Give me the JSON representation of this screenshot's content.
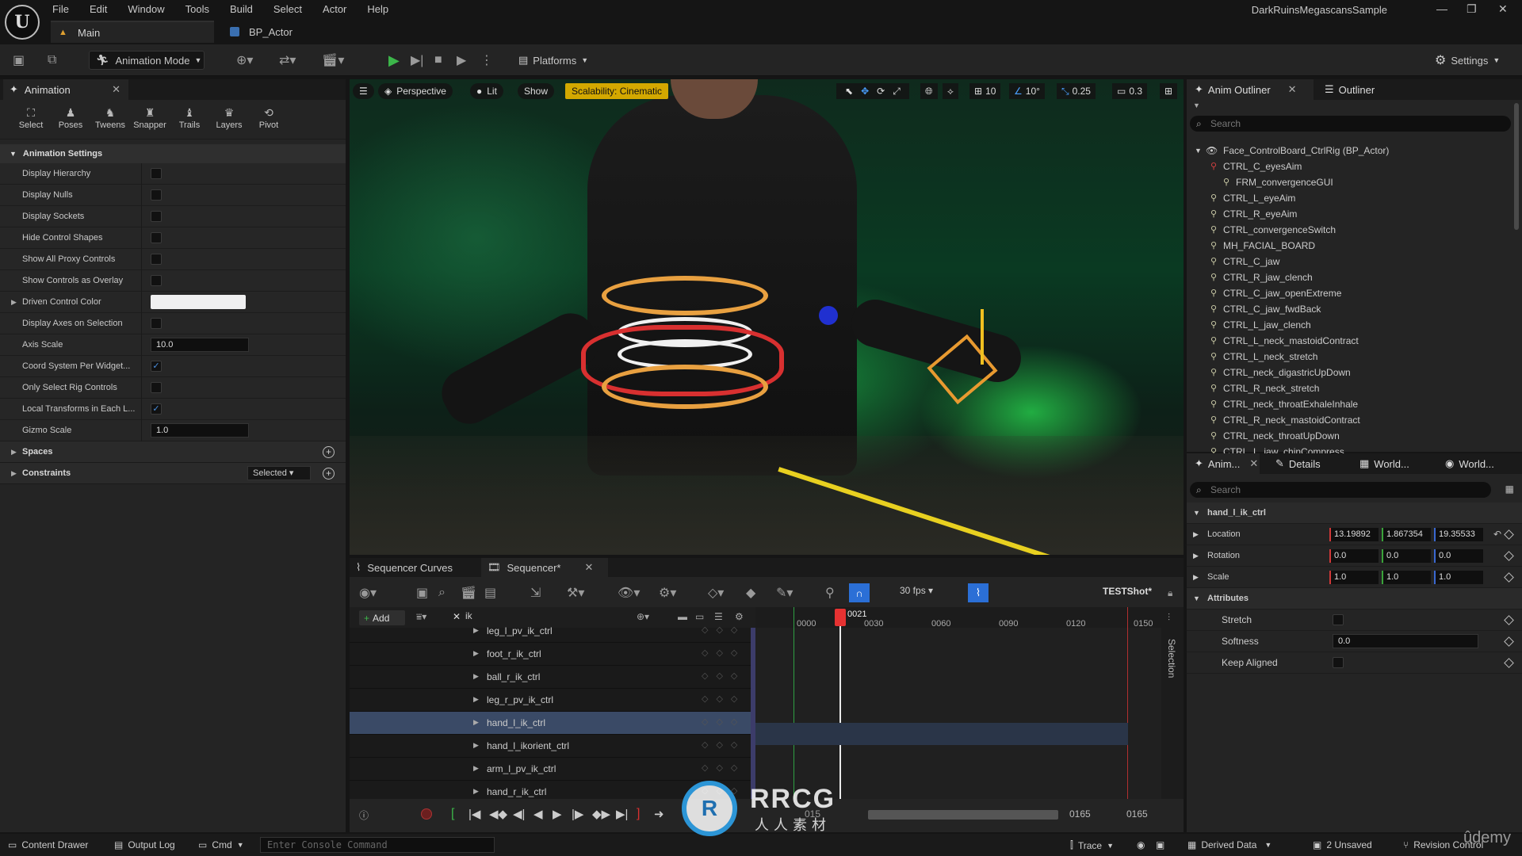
{
  "menubar": {
    "logo": "U",
    "items": [
      "File",
      "Edit",
      "Window",
      "Tools",
      "Build",
      "Select",
      "Actor",
      "Help"
    ],
    "project_name": "DarkRuinsMegascansSample",
    "win_controls": [
      "—",
      "❐",
      "✕"
    ]
  },
  "tabs": {
    "main": "Main",
    "bp_actor": "BP_Actor"
  },
  "toolbar": {
    "animation_mode": "Animation Mode",
    "platforms": "Platforms",
    "settings": "Settings"
  },
  "left_panel": {
    "tab": "Animation",
    "tools": [
      "Select",
      "Poses",
      "Tweens",
      "Snapper",
      "Trails",
      "Layers",
      "Pivot"
    ],
    "settings_header": "Animation Settings",
    "rows": [
      {
        "label": "Display Hierarchy",
        "type": "check",
        "checked": false
      },
      {
        "label": "Display Nulls",
        "type": "check",
        "checked": false
      },
      {
        "label": "Display Sockets",
        "type": "check",
        "checked": false
      },
      {
        "label": "Hide Control Shapes",
        "type": "check",
        "checked": false
      },
      {
        "label": "Show All Proxy Controls",
        "type": "check",
        "checked": false
      },
      {
        "label": "Show Controls as Overlay",
        "type": "check",
        "checked": false
      },
      {
        "label": "Driven Control Color",
        "type": "color",
        "value": "#efeff0"
      },
      {
        "label": "Display Axes on Selection",
        "type": "check",
        "checked": false
      },
      {
        "label": "Axis Scale",
        "type": "number",
        "value": "10.0"
      },
      {
        "label": "Coord System Per Widget...",
        "type": "check",
        "checked": true
      },
      {
        "label": "Only Select Rig Controls",
        "type": "check",
        "checked": false
      },
      {
        "label": "Local Transforms in Each L...",
        "type": "check",
        "checked": true
      },
      {
        "label": "Gizmo Scale",
        "type": "number",
        "value": "1.0"
      }
    ],
    "spaces": "Spaces",
    "constraints": "Constraints",
    "constraints_value": "Selected"
  },
  "viewport": {
    "perspective": "Perspective",
    "lit": "Lit",
    "show": "Show",
    "scalability": "Scalability: Cinematic",
    "grid_snap": "10",
    "rot_snap": "10°",
    "scale_snap": "0.25",
    "cam_speed": "0.3"
  },
  "sequencer": {
    "tab_curves": "Sequencer Curves",
    "tab_sequencer": "Sequencer*",
    "add": "Add",
    "search_value": "ik",
    "fps": "30 fps",
    "shot": "TESTShot*",
    "selection_label": "Selection",
    "tracks": [
      "leg_l_pv_ik_ctrl",
      "foot_r_ik_ctrl",
      "ball_r_ik_ctrl",
      "leg_r_pv_ik_ctrl",
      "hand_l_ik_ctrl",
      "hand_l_ikorient_ctrl",
      "arm_l_pv_ik_ctrl",
      "hand_r_ik_ctrl"
    ],
    "selected_track": "hand_l_ik_ctrl",
    "ticks": [
      "0000",
      "0030",
      "0060",
      "0090",
      "0120",
      "0150"
    ],
    "playhead": "0021",
    "bottom_start": "015",
    "bottom_end_a": "0165",
    "bottom_end_b": "0165"
  },
  "outliner": {
    "tab_anim": "Anim Outliner",
    "tab_outliner": "Outliner",
    "search_placeholder": "Search",
    "root": "Face_ControlBoard_CtrlRig (BP_Actor)",
    "items": [
      "CTRL_C_eyesAim",
      "FRM_convergenceGUI",
      "CTRL_L_eyeAim",
      "CTRL_R_eyeAim",
      "CTRL_convergenceSwitch",
      "MH_FACIAL_BOARD",
      "CTRL_C_jaw",
      "CTRL_R_jaw_clench",
      "CTRL_C_jaw_openExtreme",
      "CTRL_C_jaw_fwdBack",
      "CTRL_L_jaw_clench",
      "CTRL_L_neck_mastoidContract",
      "CTRL_L_neck_stretch",
      "CTRL_neck_digastricUpDown",
      "CTRL_R_neck_stretch",
      "CTRL_neck_throatExhaleInhale",
      "CTRL_R_neck_mastoidContract",
      "CTRL_neck_throatUpDown",
      "CTRL_L_jaw_chinCompress"
    ]
  },
  "details": {
    "tab_anim": "Anim...",
    "tab_details": "Details",
    "tab_world1": "World...",
    "tab_world2": "World...",
    "search_placeholder": "Search",
    "object": "hand_l_ik_ctrl",
    "location": {
      "label": "Location",
      "x": "13.19892",
      "y": "1.867354",
      "z": "19.35533"
    },
    "rotation": {
      "label": "Rotation",
      "x": "0.0",
      "y": "0.0",
      "z": "0.0"
    },
    "scale": {
      "label": "Scale",
      "x": "1.0",
      "y": "1.0",
      "z": "1.0"
    },
    "attributes": "Attributes",
    "stretch": "Stretch",
    "softness": "Softness",
    "softness_value": "0.0",
    "keep_aligned": "Keep Aligned"
  },
  "statusbar": {
    "content_drawer": "Content Drawer",
    "output_log": "Output Log",
    "cmd": "Cmd",
    "console_placeholder": "Enter Console Command",
    "trace": "Trace",
    "derived_data": "Derived Data",
    "unsaved": "2 Unsaved",
    "revision": "Revision Control"
  },
  "watermark": {
    "rrcg": "RRCG",
    "rrcg_sub": "人人素材",
    "udemy": "ûdemy"
  }
}
